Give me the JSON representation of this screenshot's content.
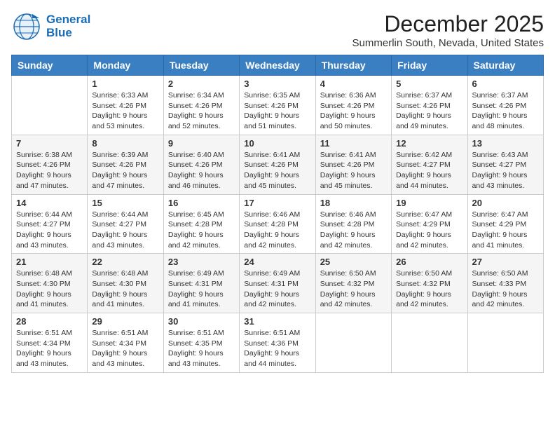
{
  "logo": {
    "line1": "General",
    "line2": "Blue"
  },
  "title": "December 2025",
  "location": "Summerlin South, Nevada, United States",
  "days_header": [
    "Sunday",
    "Monday",
    "Tuesday",
    "Wednesday",
    "Thursday",
    "Friday",
    "Saturday"
  ],
  "weeks": [
    [
      {
        "num": "",
        "info": ""
      },
      {
        "num": "1",
        "info": "Sunrise: 6:33 AM\nSunset: 4:26 PM\nDaylight: 9 hours\nand 53 minutes."
      },
      {
        "num": "2",
        "info": "Sunrise: 6:34 AM\nSunset: 4:26 PM\nDaylight: 9 hours\nand 52 minutes."
      },
      {
        "num": "3",
        "info": "Sunrise: 6:35 AM\nSunset: 4:26 PM\nDaylight: 9 hours\nand 51 minutes."
      },
      {
        "num": "4",
        "info": "Sunrise: 6:36 AM\nSunset: 4:26 PM\nDaylight: 9 hours\nand 50 minutes."
      },
      {
        "num": "5",
        "info": "Sunrise: 6:37 AM\nSunset: 4:26 PM\nDaylight: 9 hours\nand 49 minutes."
      },
      {
        "num": "6",
        "info": "Sunrise: 6:37 AM\nSunset: 4:26 PM\nDaylight: 9 hours\nand 48 minutes."
      }
    ],
    [
      {
        "num": "7",
        "info": "Sunrise: 6:38 AM\nSunset: 4:26 PM\nDaylight: 9 hours\nand 47 minutes."
      },
      {
        "num": "8",
        "info": "Sunrise: 6:39 AM\nSunset: 4:26 PM\nDaylight: 9 hours\nand 47 minutes."
      },
      {
        "num": "9",
        "info": "Sunrise: 6:40 AM\nSunset: 4:26 PM\nDaylight: 9 hours\nand 46 minutes."
      },
      {
        "num": "10",
        "info": "Sunrise: 6:41 AM\nSunset: 4:26 PM\nDaylight: 9 hours\nand 45 minutes."
      },
      {
        "num": "11",
        "info": "Sunrise: 6:41 AM\nSunset: 4:26 PM\nDaylight: 9 hours\nand 45 minutes."
      },
      {
        "num": "12",
        "info": "Sunrise: 6:42 AM\nSunset: 4:27 PM\nDaylight: 9 hours\nand 44 minutes."
      },
      {
        "num": "13",
        "info": "Sunrise: 6:43 AM\nSunset: 4:27 PM\nDaylight: 9 hours\nand 43 minutes."
      }
    ],
    [
      {
        "num": "14",
        "info": "Sunrise: 6:44 AM\nSunset: 4:27 PM\nDaylight: 9 hours\nand 43 minutes."
      },
      {
        "num": "15",
        "info": "Sunrise: 6:44 AM\nSunset: 4:27 PM\nDaylight: 9 hours\nand 43 minutes."
      },
      {
        "num": "16",
        "info": "Sunrise: 6:45 AM\nSunset: 4:28 PM\nDaylight: 9 hours\nand 42 minutes."
      },
      {
        "num": "17",
        "info": "Sunrise: 6:46 AM\nSunset: 4:28 PM\nDaylight: 9 hours\nand 42 minutes."
      },
      {
        "num": "18",
        "info": "Sunrise: 6:46 AM\nSunset: 4:28 PM\nDaylight: 9 hours\nand 42 minutes."
      },
      {
        "num": "19",
        "info": "Sunrise: 6:47 AM\nSunset: 4:29 PM\nDaylight: 9 hours\nand 42 minutes."
      },
      {
        "num": "20",
        "info": "Sunrise: 6:47 AM\nSunset: 4:29 PM\nDaylight: 9 hours\nand 41 minutes."
      }
    ],
    [
      {
        "num": "21",
        "info": "Sunrise: 6:48 AM\nSunset: 4:30 PM\nDaylight: 9 hours\nand 41 minutes."
      },
      {
        "num": "22",
        "info": "Sunrise: 6:48 AM\nSunset: 4:30 PM\nDaylight: 9 hours\nand 41 minutes."
      },
      {
        "num": "23",
        "info": "Sunrise: 6:49 AM\nSunset: 4:31 PM\nDaylight: 9 hours\nand 41 minutes."
      },
      {
        "num": "24",
        "info": "Sunrise: 6:49 AM\nSunset: 4:31 PM\nDaylight: 9 hours\nand 42 minutes."
      },
      {
        "num": "25",
        "info": "Sunrise: 6:50 AM\nSunset: 4:32 PM\nDaylight: 9 hours\nand 42 minutes."
      },
      {
        "num": "26",
        "info": "Sunrise: 6:50 AM\nSunset: 4:32 PM\nDaylight: 9 hours\nand 42 minutes."
      },
      {
        "num": "27",
        "info": "Sunrise: 6:50 AM\nSunset: 4:33 PM\nDaylight: 9 hours\nand 42 minutes."
      }
    ],
    [
      {
        "num": "28",
        "info": "Sunrise: 6:51 AM\nSunset: 4:34 PM\nDaylight: 9 hours\nand 43 minutes."
      },
      {
        "num": "29",
        "info": "Sunrise: 6:51 AM\nSunset: 4:34 PM\nDaylight: 9 hours\nand 43 minutes."
      },
      {
        "num": "30",
        "info": "Sunrise: 6:51 AM\nSunset: 4:35 PM\nDaylight: 9 hours\nand 43 minutes."
      },
      {
        "num": "31",
        "info": "Sunrise: 6:51 AM\nSunset: 4:36 PM\nDaylight: 9 hours\nand 44 minutes."
      },
      {
        "num": "",
        "info": ""
      },
      {
        "num": "",
        "info": ""
      },
      {
        "num": "",
        "info": ""
      }
    ]
  ]
}
